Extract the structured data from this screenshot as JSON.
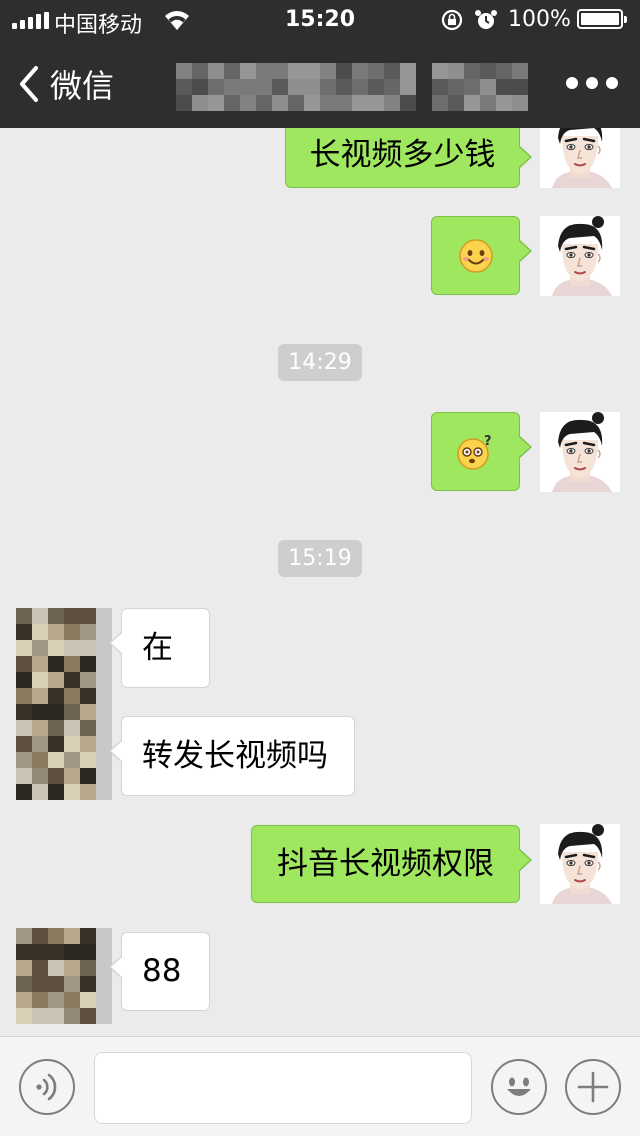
{
  "status_bar": {
    "carrier": "中国移动",
    "time": "15:20",
    "battery_percent": "100%",
    "icons": [
      "signal-icon",
      "wifi-icon",
      "rotation-lock-icon",
      "alarm-icon",
      "battery-icon"
    ]
  },
  "nav": {
    "back_label": "微信",
    "title": "",
    "title_obscured": true,
    "more_icon": "more-dots-icon"
  },
  "colors": {
    "bar_bg": "#2e2e2e",
    "chat_bg": "#ebebeb",
    "my_bubble": "#9fe75f",
    "their_bubble": "#ffffff",
    "timestamp_bg": "#cecece"
  },
  "messages": [
    {
      "sender": "me",
      "kind": "text",
      "text": "长视频多少钱"
    },
    {
      "sender": "me",
      "kind": "emoji",
      "emoji": "smile-emoji"
    },
    {
      "kind": "timestamp",
      "text": "14:29"
    },
    {
      "sender": "me",
      "kind": "emoji",
      "emoji": "dizzy-question-emoji"
    },
    {
      "kind": "timestamp",
      "text": "15:19"
    },
    {
      "sender": "other",
      "kind": "text",
      "text": "在"
    },
    {
      "sender": "other",
      "kind": "text",
      "text": "转发长视频吗"
    },
    {
      "sender": "me",
      "kind": "text",
      "text": "抖音长视频权限"
    },
    {
      "sender": "other",
      "kind": "text",
      "text": "88"
    }
  ],
  "input_bar": {
    "voice_icon": "voice-icon",
    "text_value": "",
    "emoji_icon": "emoji-face-icon",
    "plus_icon": "plus-icon"
  }
}
